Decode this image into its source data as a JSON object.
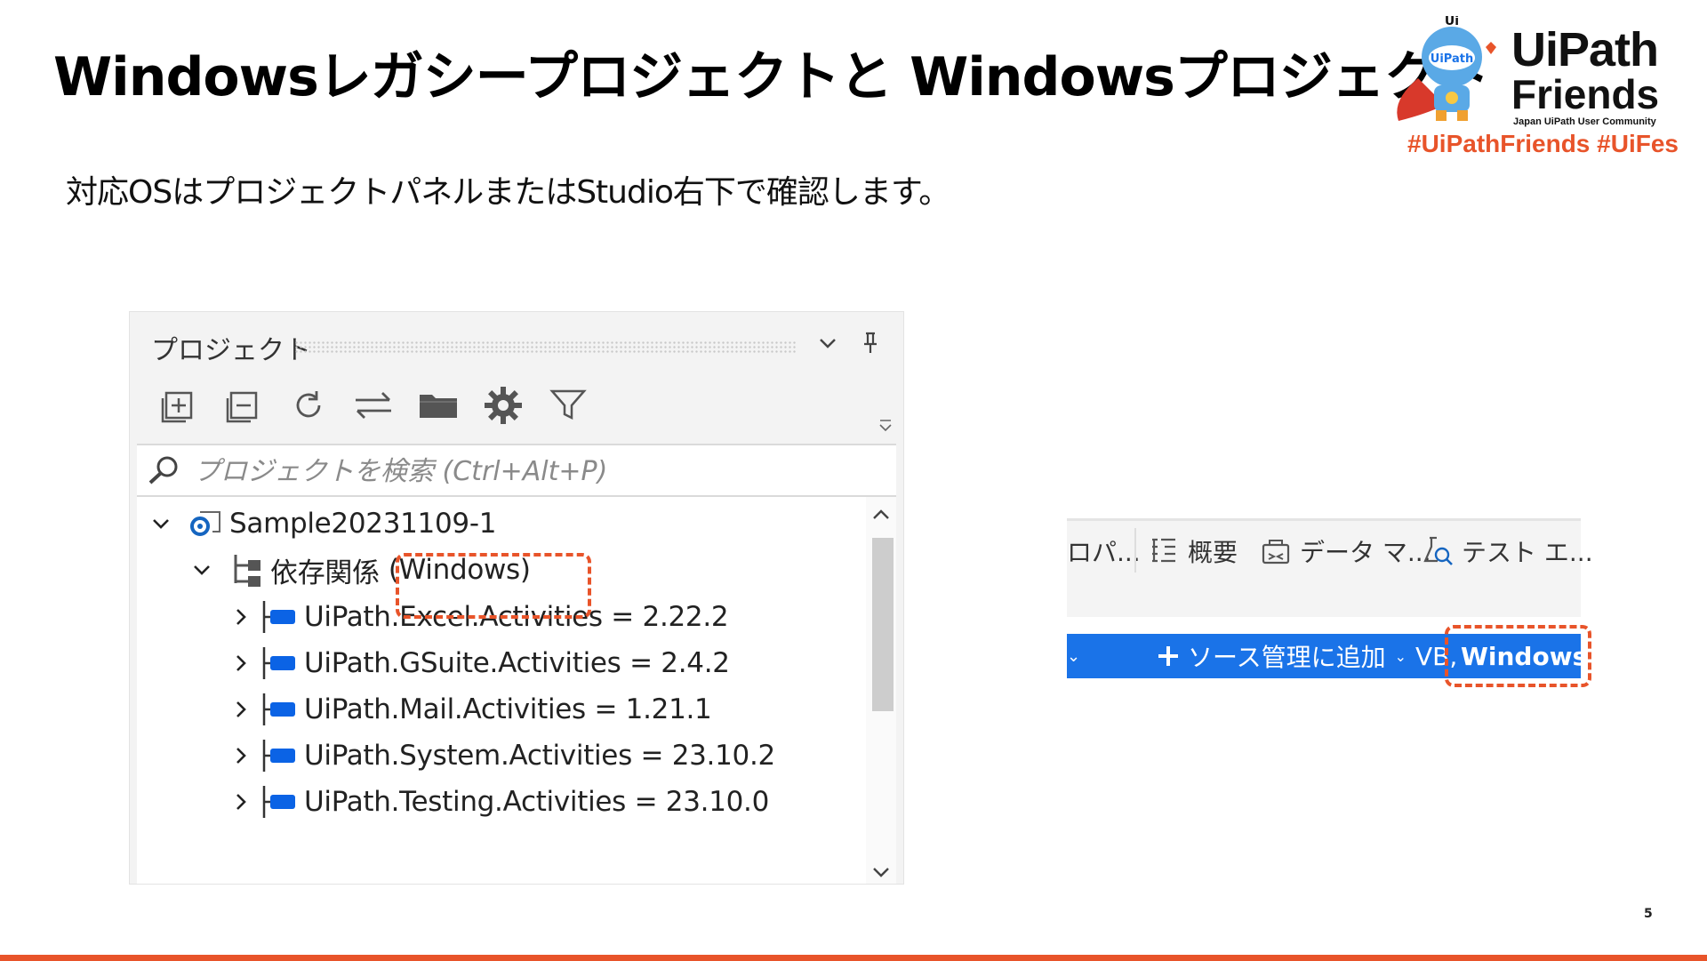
{
  "slide": {
    "title": "Windowsレガシープロジェクトと Windowsプロジェクト",
    "subtitle": "対応OSはプロジェクトパネルまたはStudio右下で確認します。",
    "page_number": "5"
  },
  "logo": {
    "brand_line1": "UiPath",
    "brand_line2": "Friends",
    "tagline": "Japan UiPath User Community",
    "hashtags": "#UiPathFriends  #UiFes",
    "mascot_badge": "UiPath",
    "mascot_top": "Ui"
  },
  "project_panel": {
    "title": "プロジェクト",
    "search_placeholder": "プロジェクトを検索 (Ctrl+Alt+P)",
    "root_item": "Sample20231109-1",
    "dependencies_label": "依存関係",
    "dependencies_os": "(Windows)",
    "packages": [
      "UiPath.Excel.Activities  =  2.22.2",
      "UiPath.GSuite.Activities  =  2.4.2",
      "UiPath.Mail.Activities  =  1.21.1",
      "UiPath.System.Activities  =  23.10.2",
      "UiPath.Testing.Activities  =  23.10.0"
    ],
    "toolbar_icons": [
      "expand-all-icon",
      "collapse-all-icon",
      "refresh-icon",
      "sync-icon",
      "folder-icon",
      "settings-icon",
      "filter-icon"
    ]
  },
  "status_bar": {
    "tabs": [
      "ロパ...",
      "概要",
      "データ マ...",
      "テスト エ..."
    ],
    "add_source_control": "ソース管理に追加",
    "language": "VB",
    "target_os": "Windows"
  },
  "colors": {
    "accent_orange": "#e8542a",
    "studio_blue": "#1a73e8",
    "package_icon_blue": "#0b63e5"
  }
}
